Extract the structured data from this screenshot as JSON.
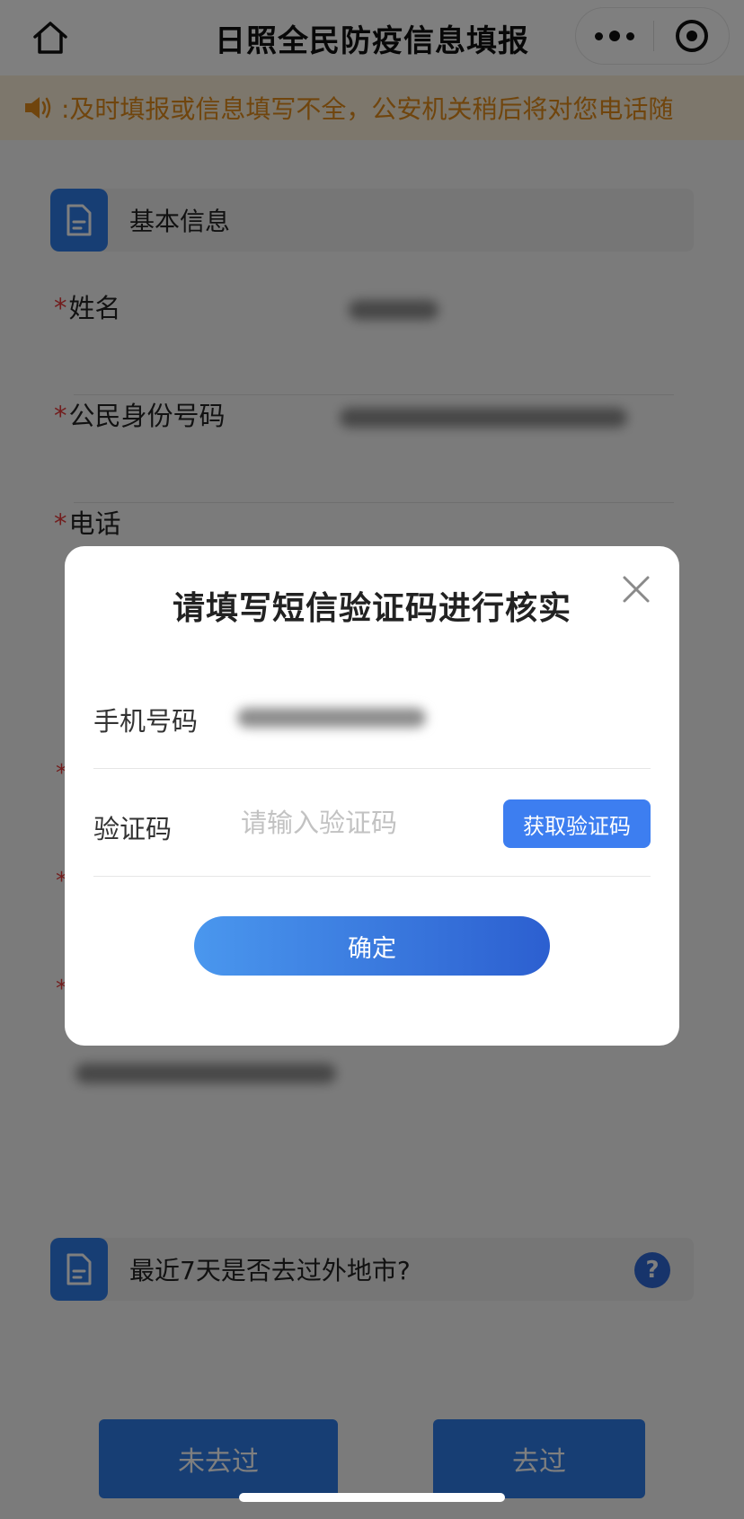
{
  "navbar": {
    "title": "日照全民防疫信息填报"
  },
  "notice": {
    "text": ":及时填报或信息填写不全，公安机关稍后将对您电话随"
  },
  "basic_section": {
    "title": "基本信息",
    "fields": [
      {
        "label": "姓名"
      },
      {
        "label": "公民身份号码"
      },
      {
        "label": "电话"
      }
    ]
  },
  "travel_section": {
    "title": "最近7天是否去过外地市?",
    "help": "?",
    "options": [
      "未去过",
      "去过"
    ]
  },
  "modal": {
    "title": "请填写短信验证码进行核实",
    "phone_label": "手机号码",
    "code_label": "验证码",
    "code_placeholder": "请输入验证码",
    "get_code_label": "获取验证码",
    "confirm_label": "确定"
  },
  "colors": {
    "primary": "#2f7de8",
    "notice_text": "#e08a1a",
    "required": "#e43b3b"
  }
}
